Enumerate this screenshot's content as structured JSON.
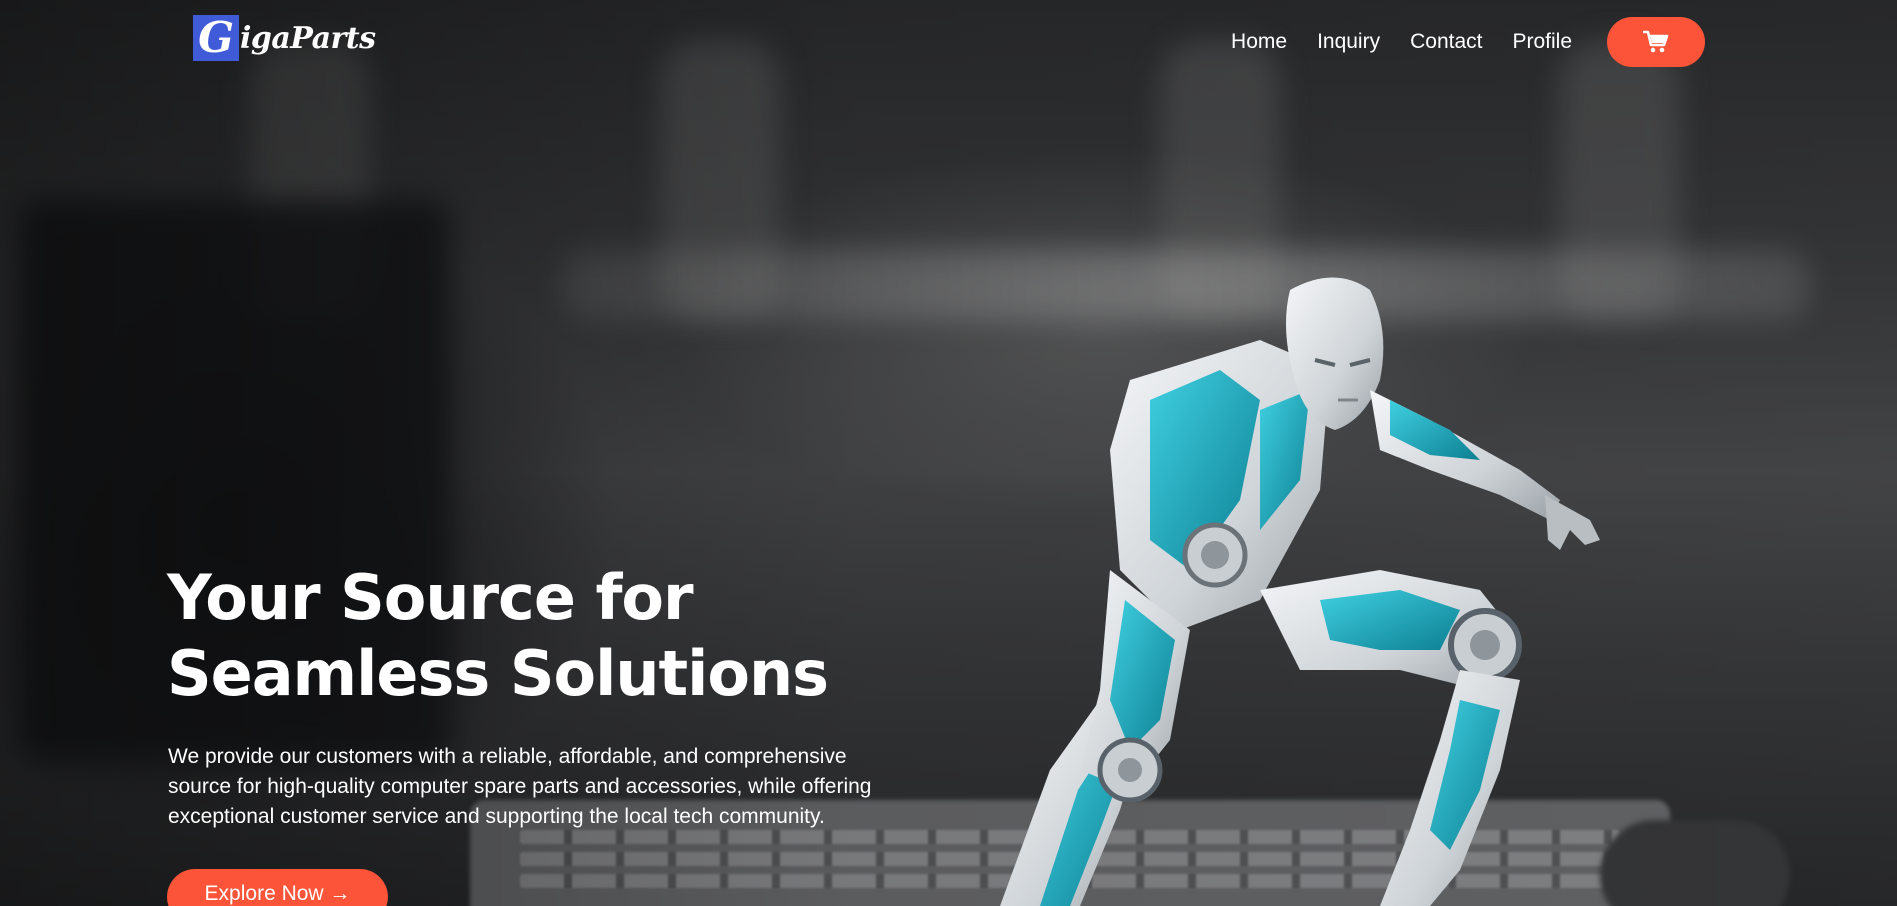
{
  "brand": {
    "logo_initial": "G",
    "logo_rest": "igaParts",
    "accent_color": "#fb5438",
    "logo_color": "#3f5bd8"
  },
  "nav": {
    "links": [
      "Home",
      "Inquiry",
      "Contact",
      "Profile"
    ],
    "cart_icon": "cart-icon"
  },
  "hero": {
    "title_lines": [
      "Your Source for",
      "Seamless Solutions"
    ],
    "description_lines": [
      "We provide our customers with a reliable, affordable, and comprehensive",
      "source for high-quality computer spare parts and accessories, while offering",
      "exceptional customer service and supporting the local tech community."
    ],
    "cta_label": "Explore Now →",
    "image": "robot-illustration"
  }
}
